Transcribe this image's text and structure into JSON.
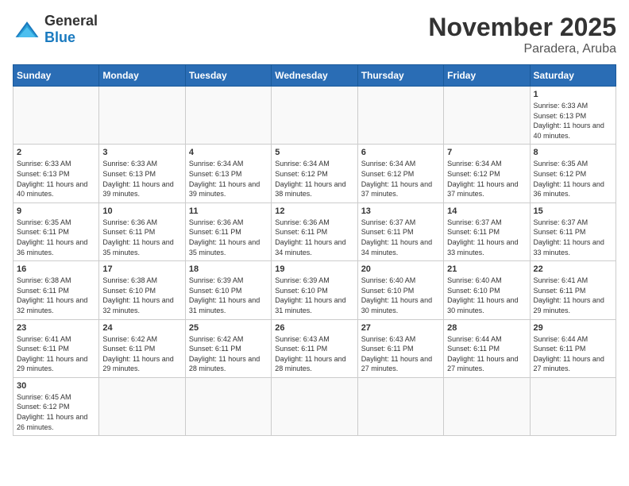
{
  "header": {
    "logo_general": "General",
    "logo_blue": "Blue",
    "month_title": "November 2025",
    "subtitle": "Paradera, Aruba"
  },
  "days_of_week": [
    "Sunday",
    "Monday",
    "Tuesday",
    "Wednesday",
    "Thursday",
    "Friday",
    "Saturday"
  ],
  "weeks": [
    [
      {
        "day": "",
        "info": ""
      },
      {
        "day": "",
        "info": ""
      },
      {
        "day": "",
        "info": ""
      },
      {
        "day": "",
        "info": ""
      },
      {
        "day": "",
        "info": ""
      },
      {
        "day": "",
        "info": ""
      },
      {
        "day": "1",
        "info": "Sunrise: 6:33 AM\nSunset: 6:13 PM\nDaylight: 11 hours\nand 40 minutes."
      }
    ],
    [
      {
        "day": "2",
        "info": "Sunrise: 6:33 AM\nSunset: 6:13 PM\nDaylight: 11 hours\nand 40 minutes."
      },
      {
        "day": "3",
        "info": "Sunrise: 6:33 AM\nSunset: 6:13 PM\nDaylight: 11 hours\nand 39 minutes."
      },
      {
        "day": "4",
        "info": "Sunrise: 6:34 AM\nSunset: 6:13 PM\nDaylight: 11 hours\nand 39 minutes."
      },
      {
        "day": "5",
        "info": "Sunrise: 6:34 AM\nSunset: 6:12 PM\nDaylight: 11 hours\nand 38 minutes."
      },
      {
        "day": "6",
        "info": "Sunrise: 6:34 AM\nSunset: 6:12 PM\nDaylight: 11 hours\nand 37 minutes."
      },
      {
        "day": "7",
        "info": "Sunrise: 6:34 AM\nSunset: 6:12 PM\nDaylight: 11 hours\nand 37 minutes."
      },
      {
        "day": "8",
        "info": "Sunrise: 6:35 AM\nSunset: 6:12 PM\nDaylight: 11 hours\nand 36 minutes."
      }
    ],
    [
      {
        "day": "9",
        "info": "Sunrise: 6:35 AM\nSunset: 6:11 PM\nDaylight: 11 hours\nand 36 minutes."
      },
      {
        "day": "10",
        "info": "Sunrise: 6:36 AM\nSunset: 6:11 PM\nDaylight: 11 hours\nand 35 minutes."
      },
      {
        "day": "11",
        "info": "Sunrise: 6:36 AM\nSunset: 6:11 PM\nDaylight: 11 hours\nand 35 minutes."
      },
      {
        "day": "12",
        "info": "Sunrise: 6:36 AM\nSunset: 6:11 PM\nDaylight: 11 hours\nand 34 minutes."
      },
      {
        "day": "13",
        "info": "Sunrise: 6:37 AM\nSunset: 6:11 PM\nDaylight: 11 hours\nand 34 minutes."
      },
      {
        "day": "14",
        "info": "Sunrise: 6:37 AM\nSunset: 6:11 PM\nDaylight: 11 hours\nand 33 minutes."
      },
      {
        "day": "15",
        "info": "Sunrise: 6:37 AM\nSunset: 6:11 PM\nDaylight: 11 hours\nand 33 minutes."
      }
    ],
    [
      {
        "day": "16",
        "info": "Sunrise: 6:38 AM\nSunset: 6:11 PM\nDaylight: 11 hours\nand 32 minutes."
      },
      {
        "day": "17",
        "info": "Sunrise: 6:38 AM\nSunset: 6:10 PM\nDaylight: 11 hours\nand 32 minutes."
      },
      {
        "day": "18",
        "info": "Sunrise: 6:39 AM\nSunset: 6:10 PM\nDaylight: 11 hours\nand 31 minutes."
      },
      {
        "day": "19",
        "info": "Sunrise: 6:39 AM\nSunset: 6:10 PM\nDaylight: 11 hours\nand 31 minutes."
      },
      {
        "day": "20",
        "info": "Sunrise: 6:40 AM\nSunset: 6:10 PM\nDaylight: 11 hours\nand 30 minutes."
      },
      {
        "day": "21",
        "info": "Sunrise: 6:40 AM\nSunset: 6:10 PM\nDaylight: 11 hours\nand 30 minutes."
      },
      {
        "day": "22",
        "info": "Sunrise: 6:41 AM\nSunset: 6:11 PM\nDaylight: 11 hours\nand 29 minutes."
      }
    ],
    [
      {
        "day": "23",
        "info": "Sunrise: 6:41 AM\nSunset: 6:11 PM\nDaylight: 11 hours\nand 29 minutes."
      },
      {
        "day": "24",
        "info": "Sunrise: 6:42 AM\nSunset: 6:11 PM\nDaylight: 11 hours\nand 29 minutes."
      },
      {
        "day": "25",
        "info": "Sunrise: 6:42 AM\nSunset: 6:11 PM\nDaylight: 11 hours\nand 28 minutes."
      },
      {
        "day": "26",
        "info": "Sunrise: 6:43 AM\nSunset: 6:11 PM\nDaylight: 11 hours\nand 28 minutes."
      },
      {
        "day": "27",
        "info": "Sunrise: 6:43 AM\nSunset: 6:11 PM\nDaylight: 11 hours\nand 27 minutes."
      },
      {
        "day": "28",
        "info": "Sunrise: 6:44 AM\nSunset: 6:11 PM\nDaylight: 11 hours\nand 27 minutes."
      },
      {
        "day": "29",
        "info": "Sunrise: 6:44 AM\nSunset: 6:11 PM\nDaylight: 11 hours\nand 27 minutes."
      }
    ],
    [
      {
        "day": "30",
        "info": "Sunrise: 6:45 AM\nSunset: 6:12 PM\nDaylight: 11 hours\nand 26 minutes."
      },
      {
        "day": "",
        "info": ""
      },
      {
        "day": "",
        "info": ""
      },
      {
        "day": "",
        "info": ""
      },
      {
        "day": "",
        "info": ""
      },
      {
        "day": "",
        "info": ""
      },
      {
        "day": "",
        "info": ""
      }
    ]
  ]
}
